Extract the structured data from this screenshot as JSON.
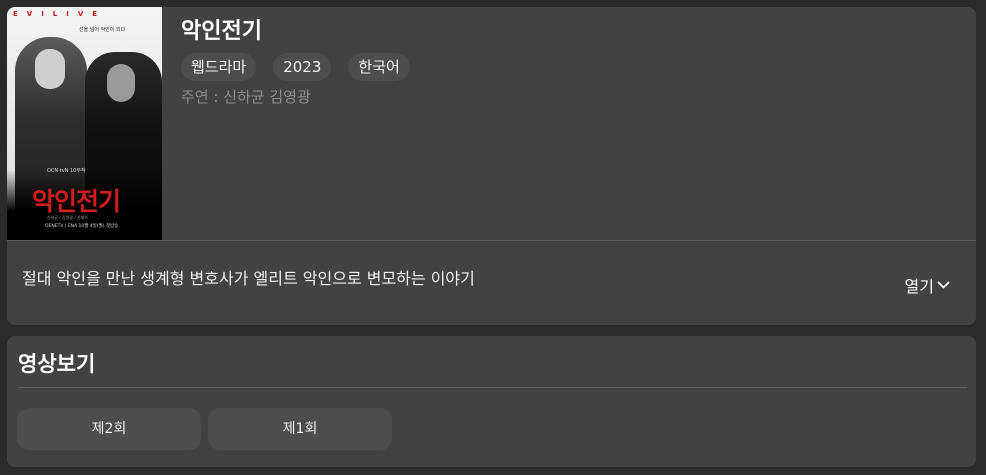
{
  "show": {
    "title": "악인전기",
    "tags": [
      "웹드라마",
      "2023",
      "한국어"
    ],
    "cast": "주연 : 신하균 김영광",
    "description": "절대 악인을 만난 생계형 변호사가 엘리트 악인으로 변모하는 이야기",
    "expand_label": "열기"
  },
  "poster": {
    "top_letters": "EVILIVE",
    "tagline": "선을 넘어 악인이 되다",
    "logo_text": "악인전기",
    "sub_text": "OCN·tvN 10부작",
    "credits": "신하균  /  김영광  /  신재하",
    "channels": "OENETV | ENA 10월 4일(월) 첫방송"
  },
  "videos": {
    "section_title": "영상보기",
    "episodes": [
      "제2회",
      "제1회"
    ]
  },
  "colors": {
    "background": "#2b2b2b",
    "card": "#424242",
    "chip": "#4d4d4d",
    "muted_text": "#8d8d8d",
    "poster_red": "#d41b1f"
  }
}
